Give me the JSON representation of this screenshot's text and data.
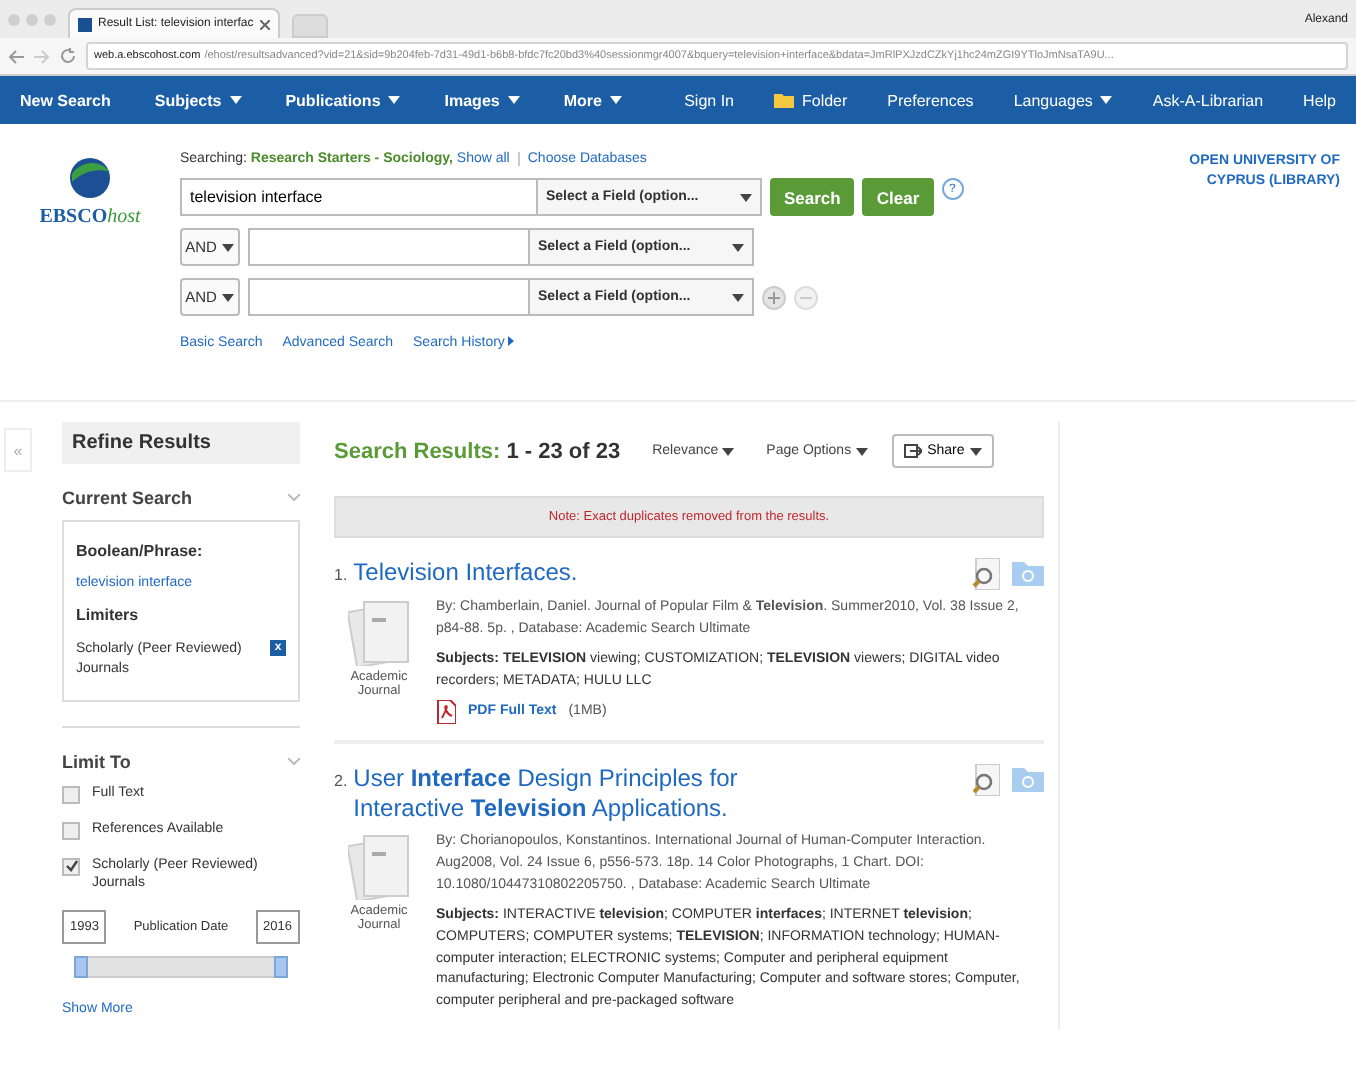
{
  "browser": {
    "tab_title": "Result List: television interfac",
    "account": "Alexand",
    "url_host": "web.a.ebscohost.com",
    "url_path": "/ehost/resultsadvanced?vid=21&sid=9b204feb-7d31-49d1-b6b8-bfdc7fc20bd3%40sessionmgr4007&bquery=television+interface&bdata=JmRlPXJzdCZkYj1hc24mZGI9YTloJmNsaTA9U..."
  },
  "nav": {
    "left": [
      {
        "label": "New Search",
        "dropdown": false
      },
      {
        "label": "Subjects",
        "dropdown": true
      },
      {
        "label": "Publications",
        "dropdown": true
      },
      {
        "label": "Images",
        "dropdown": true
      },
      {
        "label": "More",
        "dropdown": true
      }
    ],
    "right": [
      {
        "label": "Sign In",
        "kind": "link"
      },
      {
        "label": "Folder",
        "kind": "folder"
      },
      {
        "label": "Preferences",
        "kind": "link"
      },
      {
        "label": "Languages",
        "kind": "dropdown"
      },
      {
        "label": "Ask-A-Librarian",
        "kind": "link"
      },
      {
        "label": "Help",
        "kind": "link"
      }
    ]
  },
  "logo": {
    "text": "EBSCO",
    "suffix": "host"
  },
  "search": {
    "searching_label": "Searching:",
    "databases": "Research Starters - Sociology,",
    "show_all": "Show all",
    "choose": "Choose Databases",
    "rows": [
      {
        "operator": null,
        "value": "television interface",
        "field": "Select a Field (option..."
      },
      {
        "operator": "AND",
        "value": "",
        "field": "Select a Field (option..."
      },
      {
        "operator": "AND",
        "value": "",
        "field": "Select a Field (option..."
      }
    ],
    "search_button": "Search",
    "clear_button": "Clear",
    "help": "?",
    "links": [
      "Basic Search",
      "Advanced Search",
      "Search History"
    ]
  },
  "institution": "OPEN UNIVERSITY OF CYPRUS (LIBRARY)",
  "sidebar": {
    "collapse": "«",
    "title": "Refine Results",
    "current_search": {
      "heading": "Current Search",
      "boolean_heading": "Boolean/Phrase:",
      "query": "television interface",
      "limiters_heading": "Limiters",
      "limiter": "Scholarly (Peer Reviewed) Journals",
      "remove": "x"
    },
    "limit_to": {
      "heading": "Limit To",
      "options": [
        {
          "label": "Full Text",
          "checked": false
        },
        {
          "label": "References Available",
          "checked": false
        },
        {
          "label": "Scholarly (Peer Reviewed) Journals",
          "checked": true
        }
      ],
      "date_from": "1993",
      "date_label": "Publication Date",
      "date_to": "2016",
      "date_range": {
        "level": 1
      },
      "show_more": "Show More"
    }
  },
  "results": {
    "heading": "Search Results:",
    "range": "1 - 23 of 23",
    "sort": "Relevance",
    "page_options": "Page Options",
    "share": "Share",
    "note": "Note: Exact duplicates removed from the results.",
    "items": [
      {
        "number": "1.",
        "title": "Television Interfaces.",
        "type": "Academic Journal",
        "meta": "By: Chamberlain, Daniel. Journal of Popular Film & **Television**. Summer2010, Vol. 38 Issue 2, p84-88. 5p. , Database: Academic Search Ultimate",
        "subjects": "**Subjects:** **TELEVISION** viewing; CUSTOMIZATION; **TELEVISION** viewers; DIGITAL video recorders; METADATA; HULU LLC",
        "pdf": "PDF Full Text",
        "pdf_size": "(1MB)"
      },
      {
        "number": "2.",
        "title": "User **Interface** Design Principles for Interactive **Television** Applications.",
        "type": "Academic Journal",
        "meta": "By: Chorianopoulos, Konstantinos. International Journal of Human-Computer Interaction. Aug2008, Vol. 24 Issue 6, p556-573. 18p. 14 Color Photographs, 1 Chart. DOI: 10.1080/10447310802205750. , Database: Academic Search Ultimate",
        "subjects": "**Subjects:** INTERACTIVE **television**; COMPUTER **interfaces**; INTERNET **television**; COMPUTERS; COMPUTER systems; **TELEVISION**; INFORMATION technology; HUMAN-computer interaction; ELECTRONIC systems; Computer and peripheral equipment manufacturing; Electronic Computer Manufacturing; Computer and software stores; Computer, computer peripheral and pre-packaged software"
      }
    ]
  }
}
